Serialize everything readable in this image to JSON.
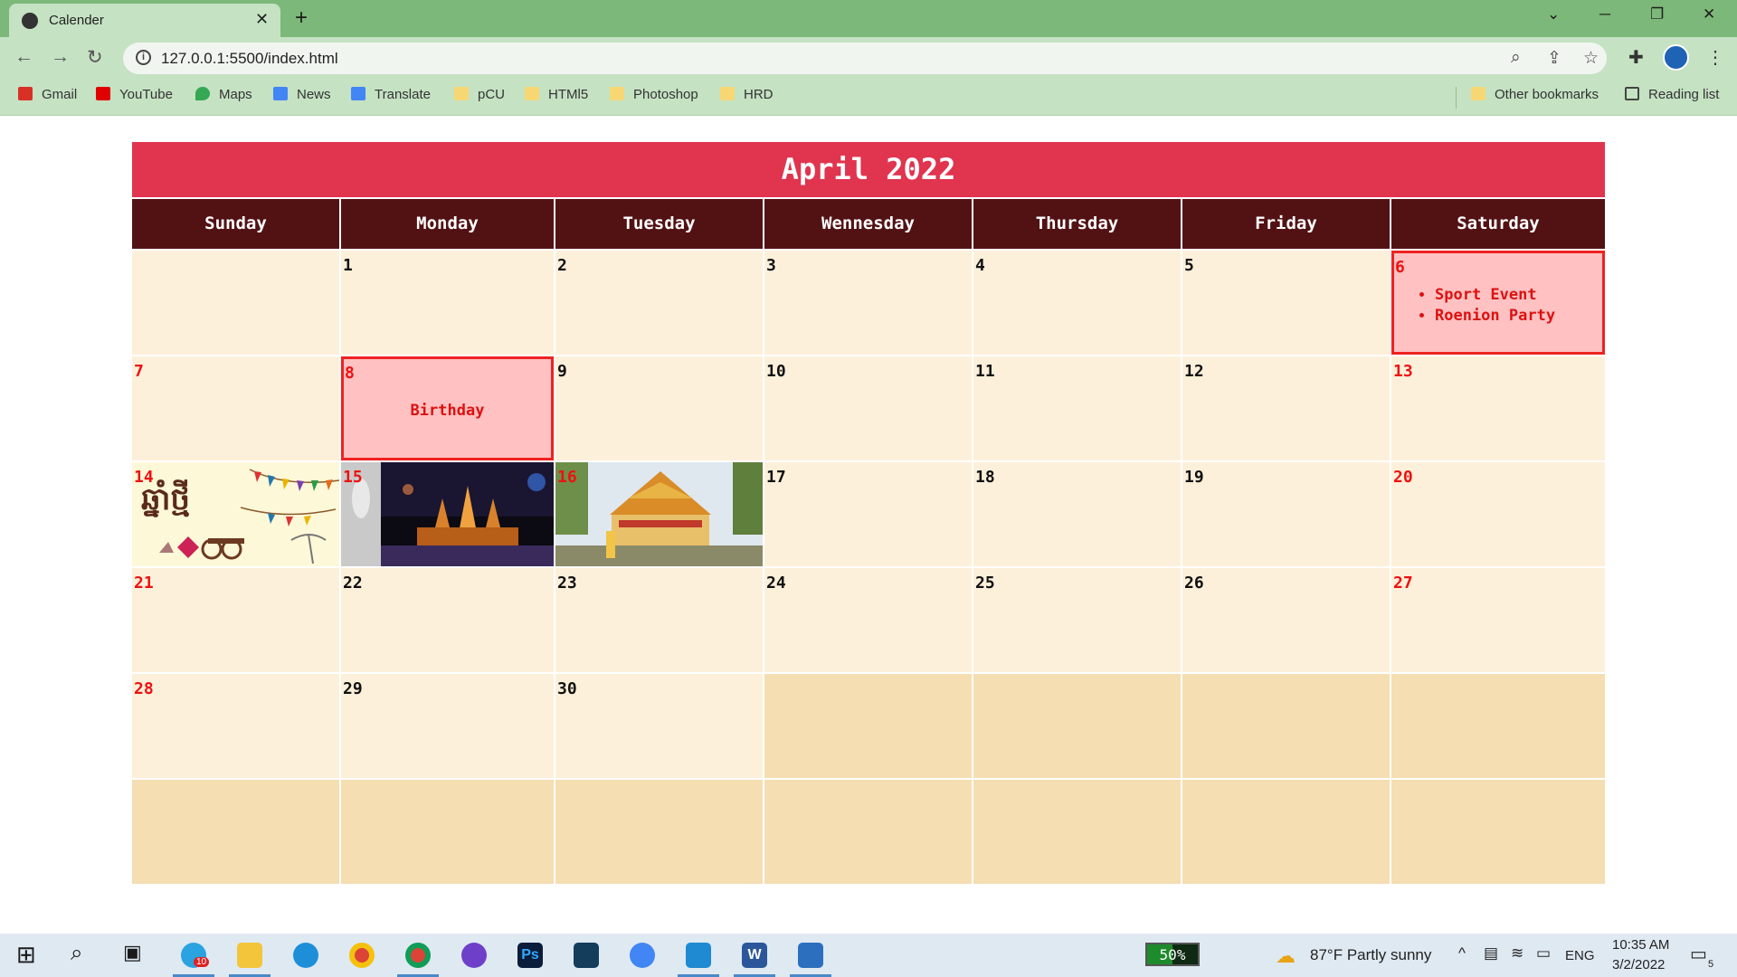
{
  "browser": {
    "tab_title": "Calender",
    "url": "127.0.0.1:5500/index.html",
    "new_tab": "+",
    "close_tab": "✕"
  },
  "bookmarks": {
    "items": [
      {
        "label": "Gmail",
        "icon": "gmail-icon",
        "color": "#d93025"
      },
      {
        "label": "YouTube",
        "icon": "youtube-icon",
        "color": "#e00000"
      },
      {
        "label": "Maps",
        "icon": "maps-icon",
        "color": "#34a853"
      },
      {
        "label": "News",
        "icon": "news-icon",
        "color": "#4285f4"
      },
      {
        "label": "Translate",
        "icon": "translate-icon",
        "color": "#4285f4"
      },
      {
        "label": "pCU",
        "icon": "folder-icon",
        "color": "#f7d774"
      },
      {
        "label": "HTMl5",
        "icon": "folder-icon",
        "color": "#f7d774"
      },
      {
        "label": "Photoshop",
        "icon": "folder-icon",
        "color": "#f7d774"
      },
      {
        "label": "HRD",
        "icon": "folder-icon",
        "color": "#f7d774"
      }
    ],
    "other": "Other bookmarks",
    "reading_list": "Reading list"
  },
  "calendar": {
    "title": "April 2022",
    "days": [
      "Sunday",
      "Monday",
      "Tuesday",
      "Wennesday",
      "Thursday",
      "Friday",
      "Saturday"
    ],
    "weeks": [
      [
        "",
        "1",
        "2",
        "3",
        "4",
        "5",
        "6"
      ],
      [
        "7",
        "8",
        "9",
        "10",
        "11",
        "12",
        "13"
      ],
      [
        "14",
        "15",
        "16",
        "17",
        "18",
        "19",
        "20"
      ],
      [
        "21",
        "22",
        "23",
        "24",
        "25",
        "26",
        "27"
      ],
      [
        "28",
        "29",
        "30",
        "",
        "",
        "",
        ""
      ],
      [
        "",
        "",
        "",
        "",
        "",
        "",
        ""
      ]
    ],
    "events": {
      "birthday": "Birthday",
      "sat6": [
        "Sport Event",
        "Roenion Party"
      ]
    },
    "colors": {
      "header": "#e0344f",
      "day_header": "#521214",
      "cell": "#fdf0da",
      "empty_cell": "#f4deb2",
      "event_bg": "#ffc1c1",
      "event_border": "#ee2222",
      "weekend_number": "#ee1111"
    }
  },
  "taskbar": {
    "battery": "50%",
    "battery_level": 0.5,
    "weather": "87°F  Partly sunny",
    "language": "ENG",
    "time": "10:35 AM",
    "date": "3/2/2022",
    "notifications": "5",
    "telegram_badge": "10"
  }
}
